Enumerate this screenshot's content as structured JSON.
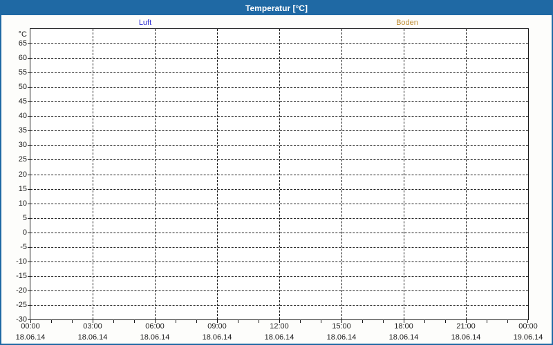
{
  "header": {
    "title": "Temperatur [°C]"
  },
  "legend": {
    "items": [
      {
        "label": "Luft",
        "color": "#2a2ad0"
      },
      {
        "label": "Boden",
        "color": "#bd8b31"
      }
    ]
  },
  "colors": {
    "accent": "#1f69a4",
    "plot_border": "#1a1a1a",
    "grid": "#1a1a1a",
    "background": "#fdfdfb"
  },
  "chart_data": {
    "type": "line",
    "title": "Temperatur [°C]",
    "xlabel": "",
    "ylabel": "°C",
    "ylim": [
      -30,
      70
    ],
    "ytick_step": 5,
    "yticks": [
      65,
      60,
      55,
      50,
      45,
      40,
      35,
      30,
      25,
      20,
      15,
      10,
      5,
      0,
      -5,
      -10,
      -15,
      -20,
      -25,
      -30
    ],
    "xticks": [
      {
        "time": "00:00",
        "date": "18.06.14"
      },
      {
        "time": "03:00",
        "date": "18.06.14"
      },
      {
        "time": "06:00",
        "date": "18.06.14"
      },
      {
        "time": "09:00",
        "date": "18.06.14"
      },
      {
        "time": "12:00",
        "date": "18.06.14"
      },
      {
        "time": "15:00",
        "date": "18.06.14"
      },
      {
        "time": "18:00",
        "date": "18.06.14"
      },
      {
        "time": "21:00",
        "date": "18.06.14"
      },
      {
        "time": "00:00",
        "date": "19.06.14"
      }
    ],
    "x_hours_total": 24,
    "x_major_tick_hours": 3,
    "x_minor_tick_hours": 1,
    "grid": true,
    "legend_position": "top",
    "series": [
      {
        "name": "Luft",
        "color": "#2a2ad0",
        "values": []
      },
      {
        "name": "Boden",
        "color": "#bd8b31",
        "values": []
      }
    ]
  }
}
